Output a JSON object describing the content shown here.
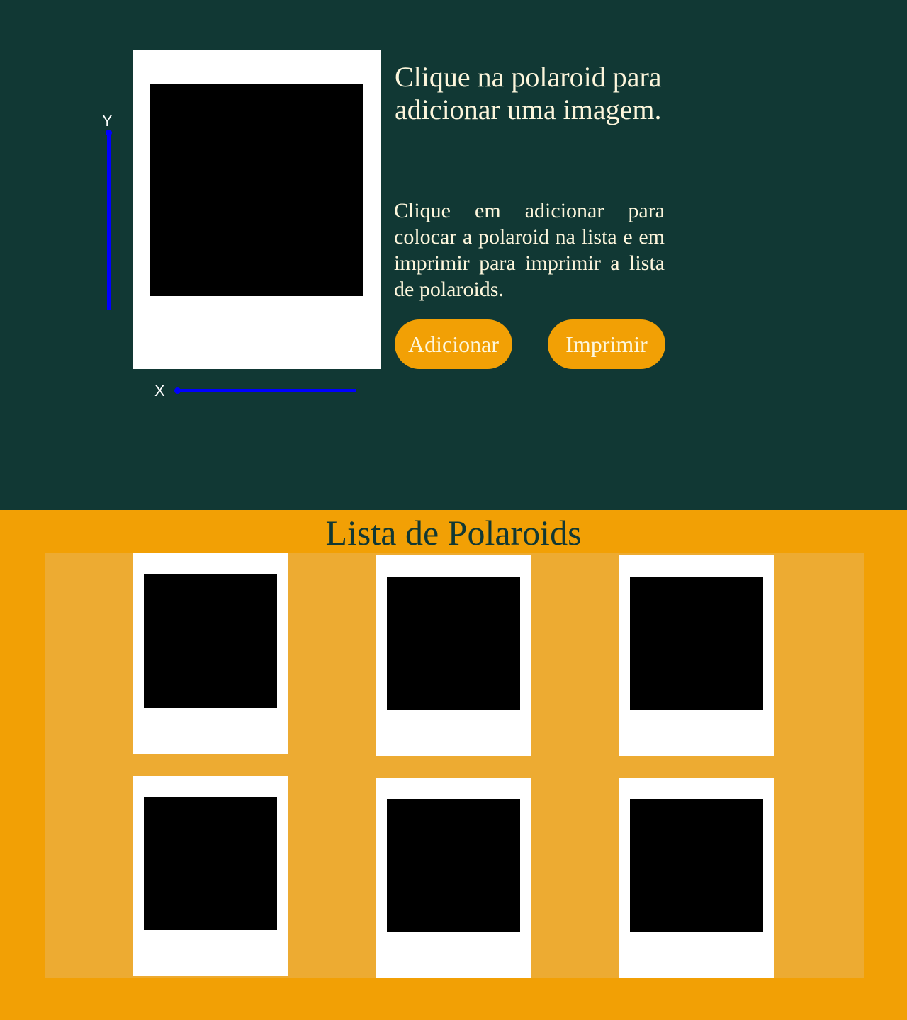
{
  "editor": {
    "heading": "Clique na polaroid para adicionar uma imagem.",
    "instructions": "Clique em adicionar para colocar a polaroid na lista e em imprimir para imprimir a lista de polaroids.",
    "add_label": "Adicionar",
    "print_label": "Imprimir",
    "slider_y_label": "Y",
    "slider_x_label": "X"
  },
  "list": {
    "title": "Lista de Polaroids",
    "item_count": 6
  },
  "colors": {
    "top_background": "#113834",
    "bottom_background": "#f2a005",
    "list_area": "#edab32",
    "accent_button": "#f2a005",
    "slider": "#0000ff",
    "text_light": "#fdf6dc",
    "text_dark": "#113834"
  }
}
